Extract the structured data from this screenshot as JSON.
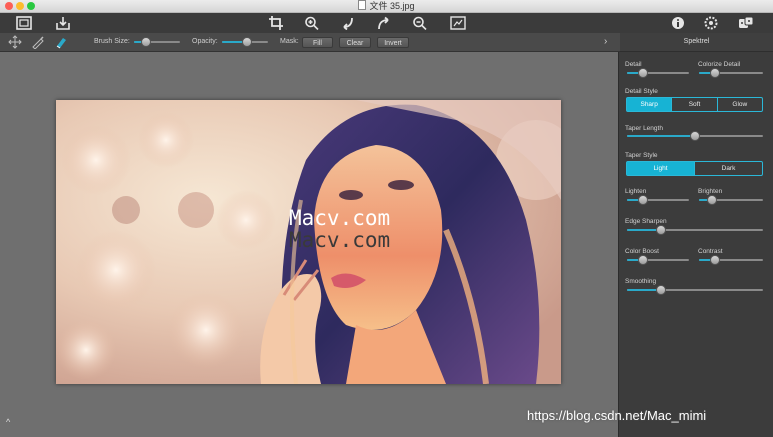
{
  "window": {
    "title": "文件 35.jpg"
  },
  "toolbar": {
    "icons": [
      "open-image-icon",
      "export-icon",
      "crop-icon",
      "zoom-in-icon",
      "undo-icon",
      "redo-icon",
      "zoom-out-icon",
      "compare-icon",
      "info-icon",
      "settings-icon",
      "presets-icon"
    ]
  },
  "brushbar": {
    "brush_size_label": "Brush Size:",
    "brush_size": 0.25,
    "opacity_label": "Opacity:",
    "opacity": 0.55,
    "mask_label": "Mask:",
    "fill_label": "Fill",
    "clear_label": "Clear",
    "invert_label": "Invert"
  },
  "panel": {
    "title": "Spektrel",
    "detail": {
      "label": "Detail",
      "value": 0.25
    },
    "colorize_detail": {
      "label": "Colorize Detail",
      "value": 0.25
    },
    "detail_style": {
      "label": "Detail Style",
      "options": [
        "Sharp",
        "Soft",
        "Glow"
      ],
      "selected": "Sharp"
    },
    "taper_length": {
      "label": "Taper Length",
      "value": 0.5
    },
    "taper_style": {
      "label": "Taper Style",
      "options": [
        "Light",
        "Dark"
      ],
      "selected": "Light"
    },
    "lighten": {
      "label": "Lighten",
      "value": 0.25
    },
    "brighten": {
      "label": "Brighten",
      "value": 0.2
    },
    "edge_sharpen": {
      "label": "Edge Sharpen",
      "value": 0.25
    },
    "color_boost": {
      "label": "Color Boost",
      "value": 0.25
    },
    "contrast": {
      "label": "Contrast",
      "value": 0.25
    },
    "smoothing": {
      "label": "Smoothing",
      "value": 0.25
    }
  },
  "canvas": {
    "watermark_1": "Macv.com",
    "watermark_2": "Macv.com"
  },
  "footer": {
    "credit": "https://blog.csdn.net/Mac_mimi"
  },
  "colors": {
    "accent": "#17b3d4",
    "panel_bg": "#3c3c3c",
    "canvas_bg": "#6f6f6f"
  }
}
